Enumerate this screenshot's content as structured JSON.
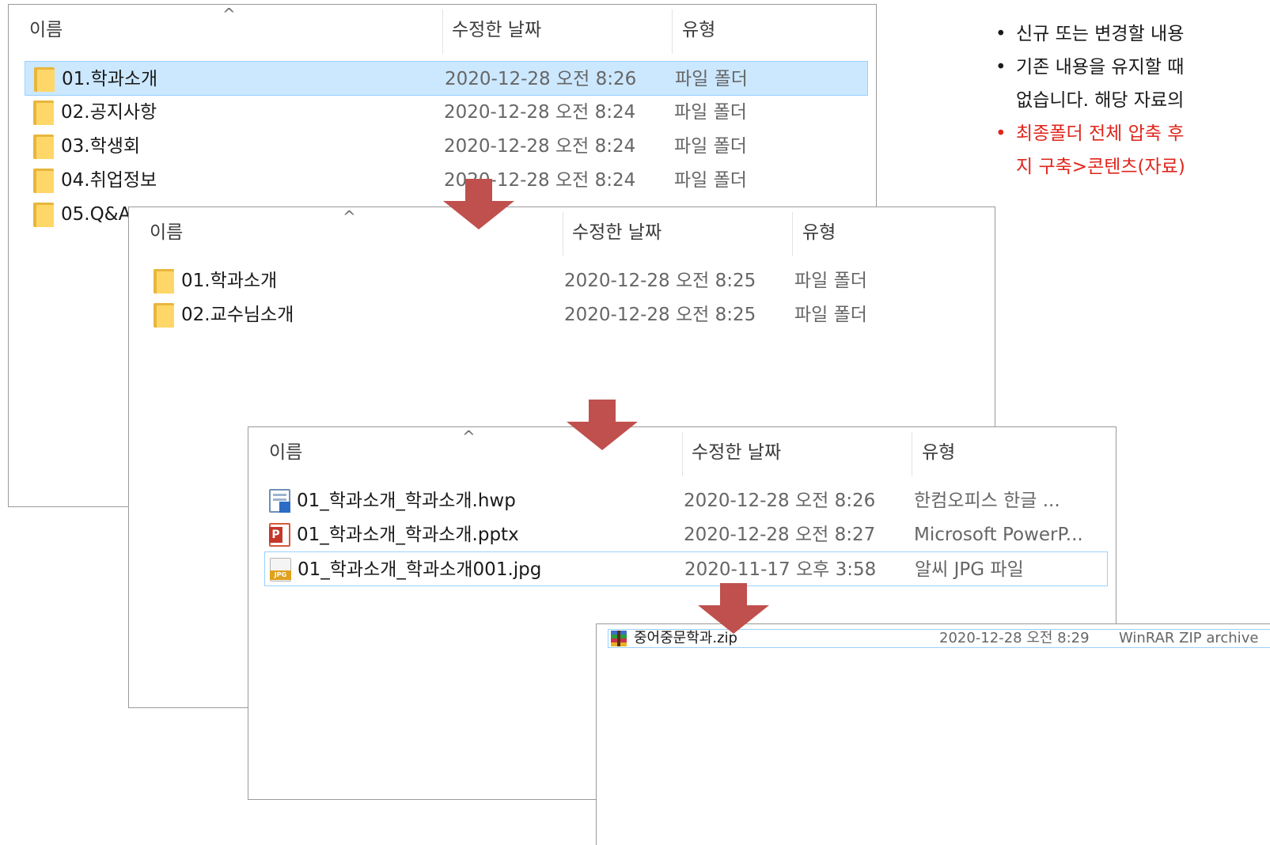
{
  "columns": {
    "name": "이름",
    "date": "수정한 날짜",
    "type": "유형"
  },
  "panel1": {
    "rows": [
      {
        "name": "01.학과소개",
        "date": "2020-12-28 오전 8:26",
        "type": "파일 폴더",
        "selected": true
      },
      {
        "name": "02.공지사항",
        "date": "2020-12-28 오전 8:24",
        "type": "파일 폴더"
      },
      {
        "name": "03.학생회",
        "date": "2020-12-28 오전 8:24",
        "type": "파일 폴더"
      },
      {
        "name": "04.취업정보",
        "date": "2020-12-28 오전 8:24",
        "type": "파일 폴더"
      },
      {
        "name": "05.Q&A"
      }
    ]
  },
  "panel2": {
    "rows": [
      {
        "name": "01.학과소개",
        "date": "2020-12-28 오전 8:25",
        "type": "파일 폴더"
      },
      {
        "name": "02.교수님소개",
        "date": "2020-12-28 오전 8:25",
        "type": "파일 폴더"
      }
    ]
  },
  "panel3": {
    "rows": [
      {
        "name": "01_학과소개_학과소개.hwp",
        "date": "2020-12-28 오전 8:26",
        "type": "한컴오피스 한글 ...",
        "icon": "hwp-file-icon"
      },
      {
        "name": "01_학과소개_학과소개.pptx",
        "date": "2020-12-28 오전 8:27",
        "type": "Microsoft PowerP...",
        "icon": "pptx-file-icon"
      },
      {
        "name": "01_학과소개_학과소개001.jpg",
        "date": "2020-11-17 오후 3:58",
        "type": "알씨 JPG 파일",
        "icon": "jpg-file-icon",
        "focused": true
      }
    ]
  },
  "panel4": {
    "row": {
      "name": "중어중문학과.zip",
      "date": "2020-12-28 오전 8:29",
      "type": "WinRAR ZIP archive",
      "icon": "winrar-archive-icon"
    }
  },
  "notes": [
    {
      "text": "신규 또는 변경할 내용",
      "color": "#1a1a1a"
    },
    {
      "text": "기존 내용을 유지할 때",
      "color": "#1a1a1a"
    },
    {
      "text": "없습니다. 해당 자료의",
      "color": "#1a1a1a",
      "continuation": true
    },
    {
      "text": "최종폴더 전체 압축 후",
      "color": "#e0251c"
    },
    {
      "text": "지 구축>콘텐츠(자료)",
      "color": "#e0251c",
      "continuation": true
    }
  ],
  "colors": {
    "arrow": "#c0504d",
    "selection": "#cce8ff",
    "folder": "#ffd768",
    "note_red": "#e0251c"
  }
}
